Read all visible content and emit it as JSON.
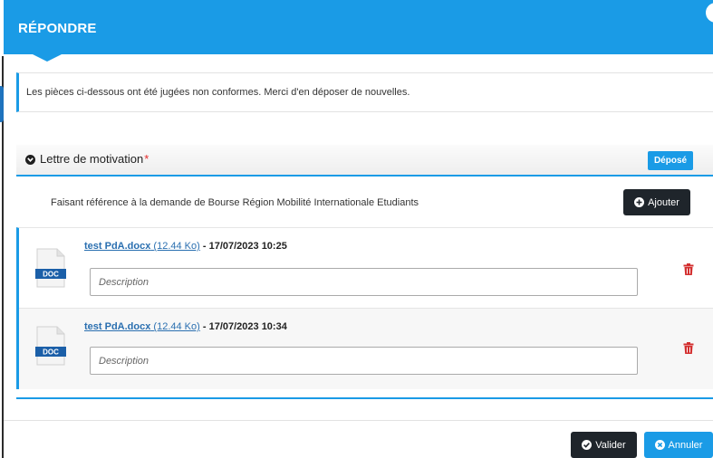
{
  "modal": {
    "title": "RÉPONDRE",
    "notice": "Les pièces ci-dessous ont été jugées non conformes. Merci d'en déposer de nouvelles."
  },
  "section": {
    "label": "Lettre de motivation",
    "required_mark": "*",
    "status_badge": "Déposé",
    "reference_text": "Faisant référence à la demande de Bourse Région Mobilité Internationale Etudiants",
    "add_button": "Ajouter"
  },
  "files": [
    {
      "icon_label": "DOC",
      "name": "test PdA.docx",
      "size": "(12.44 Ko)",
      "separator": " - ",
      "date": "17/07/2023 10:25",
      "description_placeholder": "Description",
      "description_value": ""
    },
    {
      "icon_label": "DOC",
      "name": "test PdA.docx",
      "size": "(12.44 Ko)",
      "separator": " - ",
      "date": "17/07/2023 10:34",
      "description_placeholder": "Description",
      "description_value": ""
    }
  ],
  "footer": {
    "validate_button": "Valider",
    "cancel_button": "Annuler"
  },
  "colors": {
    "primary": "#1a9be6",
    "dark_button": "#1f252b",
    "required": "#e52b2b",
    "trash": "#d32f2f",
    "link": "#2a6fb0"
  },
  "icons": {
    "section_toggle": "chevron-down-circle-icon",
    "add": "plus-circle-icon",
    "file": "doc-file-icon",
    "delete": "trash-icon",
    "validate": "check-circle-icon",
    "cancel": "close-circle-icon"
  }
}
